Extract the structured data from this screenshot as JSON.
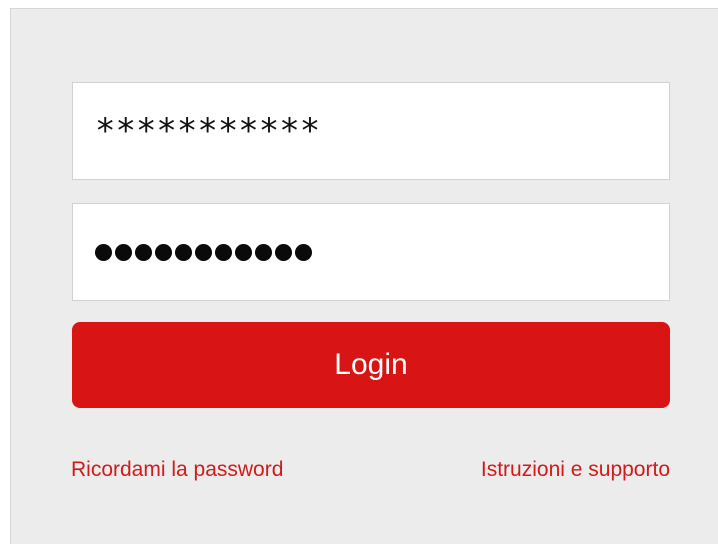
{
  "login_form": {
    "username_value": "***********",
    "password_mask_count": 11,
    "login_label": "Login",
    "remember_password_label": "Ricordami la password",
    "support_label": "Istruzioni e supporto"
  },
  "colors": {
    "panel_background": "#ececec",
    "accent_red": "#d91414",
    "link_red": "#d31a1a"
  }
}
